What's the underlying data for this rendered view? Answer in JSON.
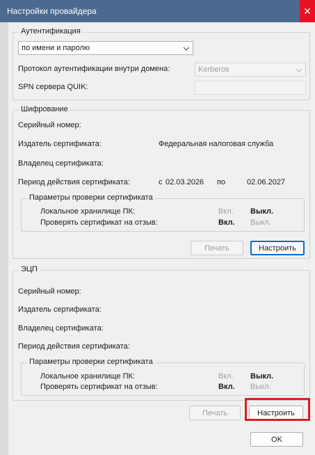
{
  "window": {
    "title": "Настройки провайдера",
    "close_glyph": "✕"
  },
  "auth": {
    "legend": "Аутентификация",
    "method": "по имени и паролю",
    "protocol_label": "Протокол аутентификации внутри домена:",
    "protocol_value": "Kerberos",
    "spn_label": "SPN сервера QUIK:"
  },
  "encryption": {
    "legend": "Шифрование",
    "serial_label": "Серийный номер:",
    "issuer_label": "Издатель сертификата:",
    "issuer_value": "Федеральная налоговая служба",
    "owner_label": "Владелец сертификата:",
    "period_label": "Период действия сертификата:",
    "period_from_word": "с",
    "period_from": "02.03.2026",
    "period_to_word": "по",
    "period_to": "02.06.2027",
    "check_legend": "Параметры проверки сертификата",
    "local_store_label": "Локальное хранилище ПК:",
    "local_on": "Вкл.",
    "local_off": "Выкл.",
    "revoke_label": "Проверять сертификат на отзыв:",
    "revoke_on": "Вкл.",
    "revoke_off": "Выкл.",
    "print_button": "Печать",
    "configure_button": "Настроить"
  },
  "ecp": {
    "legend": "ЭЦП",
    "serial_label": "Серийный номер:",
    "issuer_label": "Издатель сертификата:",
    "owner_label": "Владелец сертификата:",
    "period_label": "Период действия сертификата:",
    "check_legend": "Параметры проверки сертификата",
    "local_store_label": "Локальное хранилище ПК:",
    "local_on": "Вкл.",
    "local_off": "Выкл.",
    "revoke_label": "Проверять сертификат на отзыв:",
    "revoke_on": "Вкл.",
    "revoke_off": "Выкл.",
    "print_button": "Печать",
    "configure_button": "Настроить"
  },
  "ok_button": "OK",
  "colors": {
    "title_bar": "#4a6a90",
    "close": "#e81123",
    "highlight": "#e01b22",
    "accent": "#0a68d0"
  }
}
